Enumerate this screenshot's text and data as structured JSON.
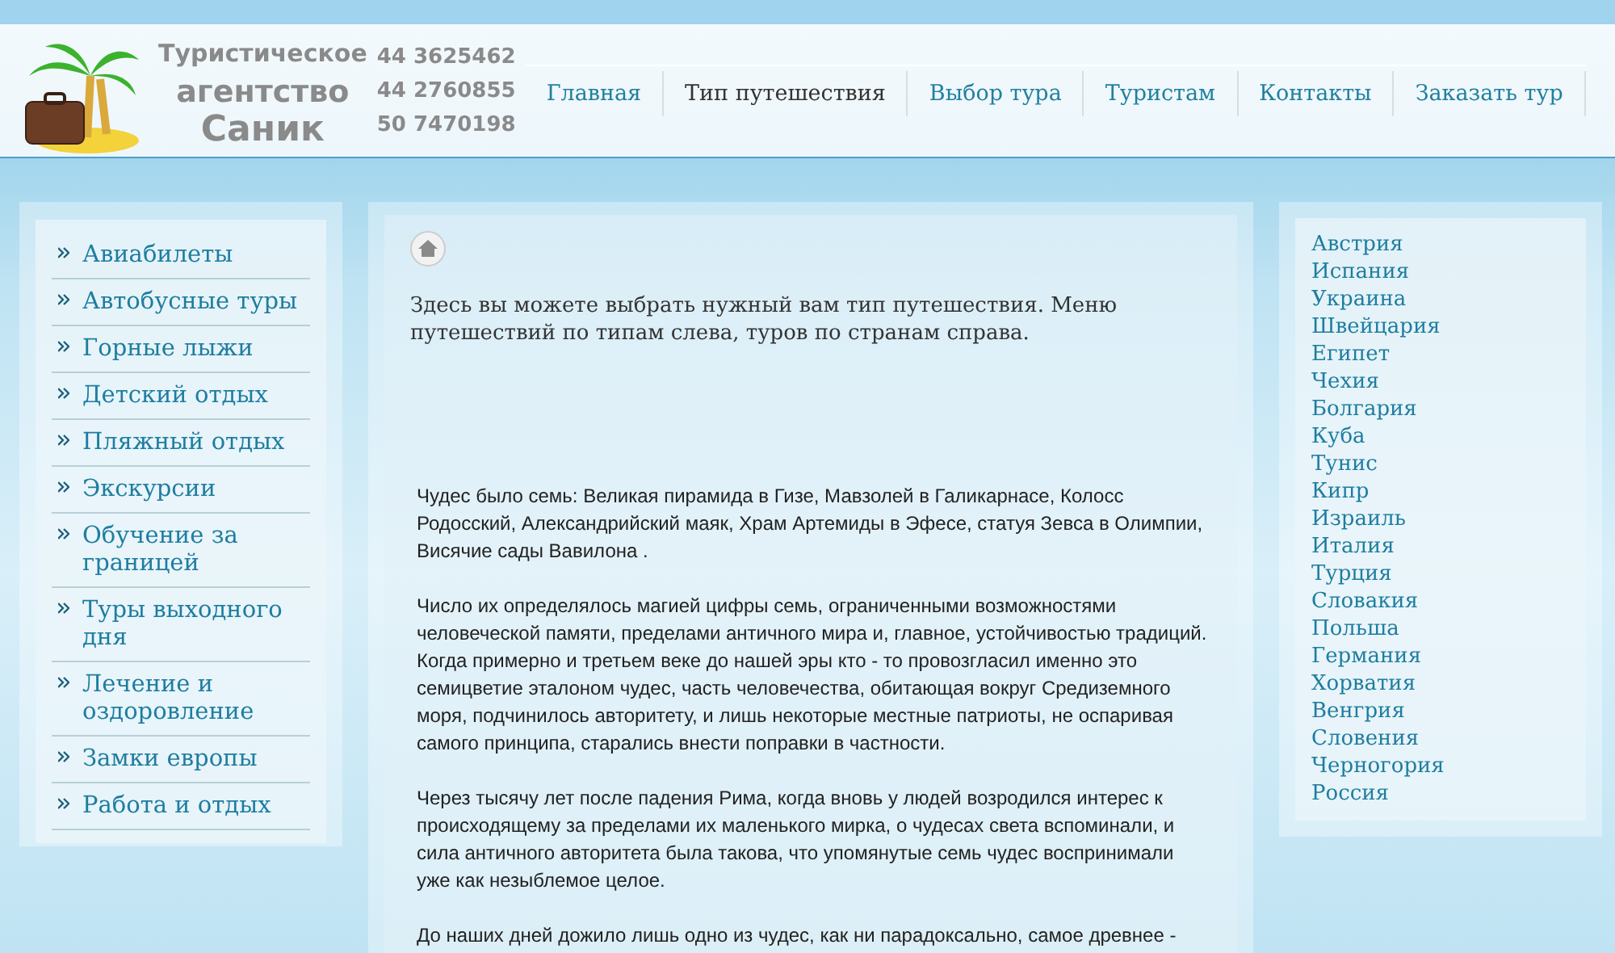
{
  "logo": {
    "lines": [
      "Туристическое",
      "агентство",
      "Саник"
    ]
  },
  "phones": [
    "44 3625462",
    "44 2760855",
    "50 7470198"
  ],
  "nav": [
    {
      "label": "Главная",
      "selected": false
    },
    {
      "label": "Тип путешествия",
      "selected": true
    },
    {
      "label": "Выбор тура",
      "selected": false
    },
    {
      "label": "Туристам",
      "selected": false
    },
    {
      "label": "Контакты",
      "selected": false
    },
    {
      "label": "Заказать тур",
      "selected": false
    }
  ],
  "sidebar": {
    "items": [
      "Авиабилеты",
      "Автобусные туры",
      "Горные лыжи",
      "Детский отдых",
      "Пляжный отдых",
      "Экскурсии",
      "Обучение за границей",
      "Туры выходного дня",
      "Лечение и оздоровление",
      "Замки европы",
      "Работа и отдых"
    ]
  },
  "content": {
    "intro": "Здесь вы можете выбрать нужный вам тип путешествия. Меню путешествий по типам слева, туров по странам справа.",
    "paragraphs": [
      "Чудес было семь: Великая пирамида в Гизе, Мавзолей в Галикарнасе, Колосс Родосский, Александрийский маяк, Храм Артемиды в Эфесе, статуя Зевса в Олимпии, Висячие сады Вавилона .",
      "Число их определялось магией цифры семь, ограниченными возможностями человеческой памяти, пределами античного мира и, главное, устойчивостью традиций. Когда примерно и третьем веке до нашей эры кто - то провозгласил именно это семицветие эталоном чудес, часть человечества, обитающая вокруг Средиземного моря, подчинилось авторитету, и лишь некоторые местные патриоты, не оспаривая самого принципа, старались внести поправки в частности.",
      "Через тысячу лет после падения Рима, когда вновь у людей возродился интерес к происходящему за пределами их маленького мирка, о чудесах света вспоминали, и сила античного авторитета была такова, что упомянутые семь чудес воспринимали уже как незыблемое целое.",
      "До наших дней дожило лишь одно из чудес, как ни парадоксально, самое древнее -"
    ]
  },
  "countries": [
    "Австрия",
    "Испания",
    "Украина",
    "Швейцария",
    "Египет",
    "Чехия",
    "Болгария",
    "Куба",
    "Тунис",
    "Кипр",
    "Израиль",
    "Италия",
    "Турция",
    "Словакия",
    "Польша",
    "Германия",
    "Хорватия",
    "Венгрия",
    "Словения",
    "Черногория",
    "Россия"
  ]
}
